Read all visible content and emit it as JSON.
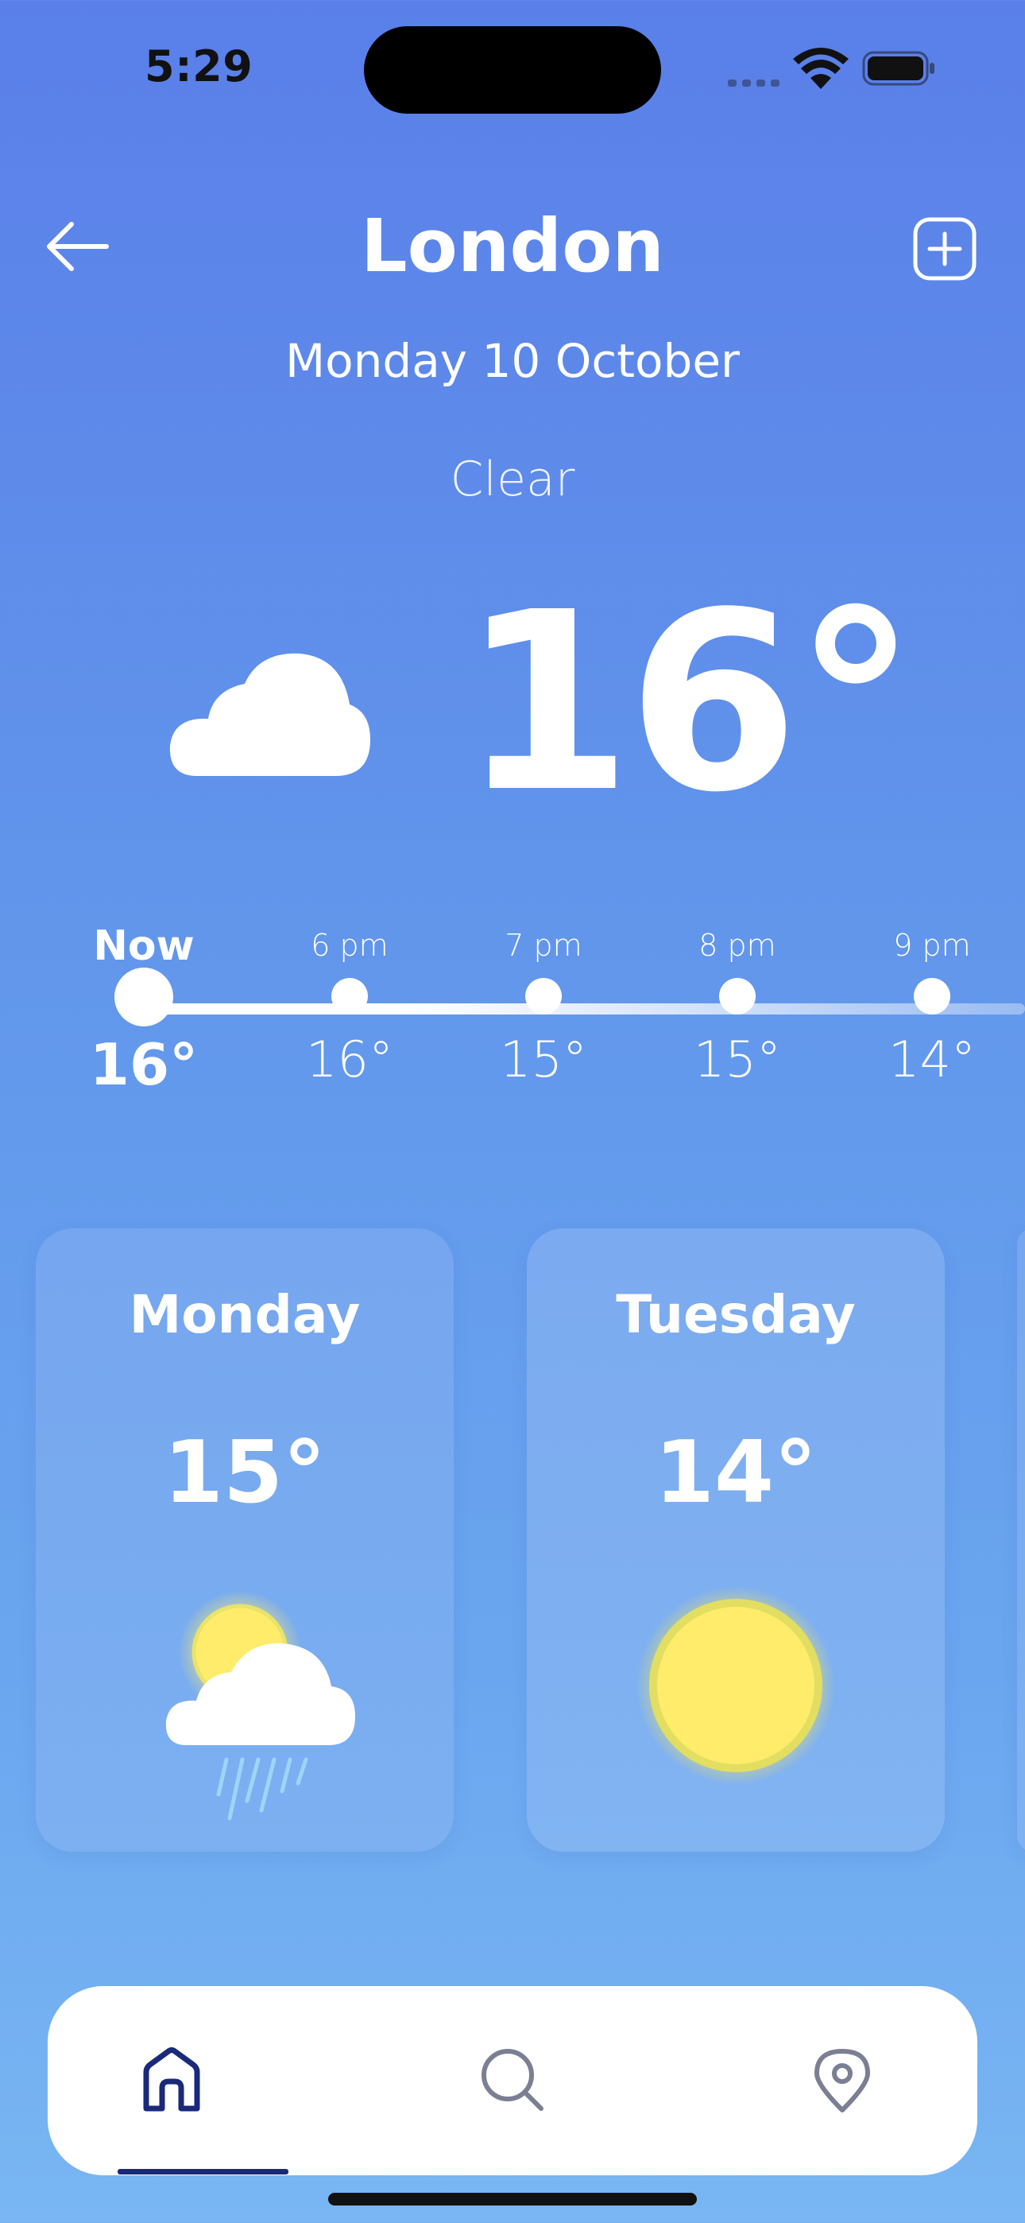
{
  "status_bar": {
    "time": "5:29"
  },
  "header": {
    "city": "London",
    "date": "Monday 10 October",
    "condition": "Clear"
  },
  "current": {
    "temperature": "16°",
    "icon": "cloud-icon"
  },
  "hourly": [
    {
      "label": "Now",
      "temp": "16°"
    },
    {
      "label": "6 pm",
      "temp": "16°"
    },
    {
      "label": "7 pm",
      "temp": "15°"
    },
    {
      "label": "8 pm",
      "temp": "15°"
    },
    {
      "label": "9 pm",
      "temp": "14°"
    }
  ],
  "days": [
    {
      "name": "Monday",
      "temp": "15°",
      "icon": "sun-cloud-rain-icon"
    },
    {
      "name": "Tuesday",
      "temp": "14°",
      "icon": "sun-icon"
    }
  ],
  "nav": {
    "items": [
      {
        "icon": "home-icon",
        "active": true
      },
      {
        "icon": "search-icon",
        "active": false
      },
      {
        "icon": "location-pin-icon",
        "active": false
      }
    ]
  },
  "colors": {
    "background_top": "#5a7fe9",
    "background_bottom": "#79b6f3",
    "nav_active": "#1a2a7a",
    "nav_inactive": "#7b7f93",
    "sun": "#ffec6a"
  }
}
